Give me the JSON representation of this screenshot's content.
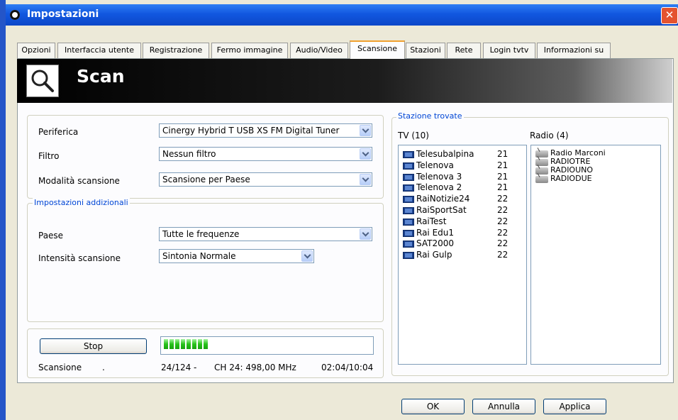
{
  "window": {
    "title": "Impostazioni",
    "close_glyph": "✕"
  },
  "tabs": [
    {
      "label": "Opzioni"
    },
    {
      "label": "Interfaccia utente"
    },
    {
      "label": "Registrazione"
    },
    {
      "label": "Fermo immagine"
    },
    {
      "label": "Audio/Video"
    },
    {
      "label": "Scansione",
      "active": true
    },
    {
      "label": "Stazioni"
    },
    {
      "label": "Rete"
    },
    {
      "label": "Login tvtv"
    },
    {
      "label": "Informazioni su"
    }
  ],
  "banner": {
    "title": "Scan",
    "icon": "magnifier-icon"
  },
  "device": {
    "periferica_label": "Periferica",
    "periferica_value": "Cinergy Hybrid T USB XS FM Digital Tuner",
    "filtro_label": "Filtro",
    "filtro_value": "Nessun filtro",
    "modalita_label": "Modalità scansione",
    "modalita_value": "Scansione per Paese"
  },
  "additional": {
    "title": "Impostazioni addizionali",
    "paese_label": "Paese",
    "paese_value": "Tutte le frequenze",
    "intensita_label": "Intensità scansione",
    "intensita_value": "Sintonia Normale"
  },
  "scan": {
    "stop_label": "Stop",
    "progress_fraction": 0.19,
    "progress_blocks": 8,
    "status_label": "Scansione",
    "status_dot": ".",
    "count": "24/124 -",
    "channel": "CH 24: 498,00 MHz",
    "time": "02:04/10:04"
  },
  "stations": {
    "title": "Stazione trovate",
    "tv_header": "TV (10)",
    "radio_header": "Radio (4)",
    "tv": [
      {
        "name": "Telesubalpina",
        "ch": "21"
      },
      {
        "name": "Telenova",
        "ch": "21"
      },
      {
        "name": "Telenova 3",
        "ch": "21"
      },
      {
        "name": "Telenova 2",
        "ch": "21"
      },
      {
        "name": "RaiNotizie24",
        "ch": "22"
      },
      {
        "name": "RaiSportSat",
        "ch": "22"
      },
      {
        "name": "RaiTest",
        "ch": "22"
      },
      {
        "name": "Rai Edu1",
        "ch": "22"
      },
      {
        "name": "SAT2000",
        "ch": "22"
      },
      {
        "name": "Rai Gulp",
        "ch": "22"
      }
    ],
    "radio": [
      {
        "name": "Radio Marconi"
      },
      {
        "name": "RADIOTRE"
      },
      {
        "name": "RADIOUNO"
      },
      {
        "name": "RADIODUE"
      }
    ]
  },
  "footer": {
    "ok_label": "OK",
    "annulla_label": "Annulla",
    "applica_label": "Applica"
  },
  "colors": {
    "title_bar": "#1157e0",
    "group_title": "#0046d5",
    "progress": "#27c21a",
    "active_tab": "#f0a030"
  }
}
